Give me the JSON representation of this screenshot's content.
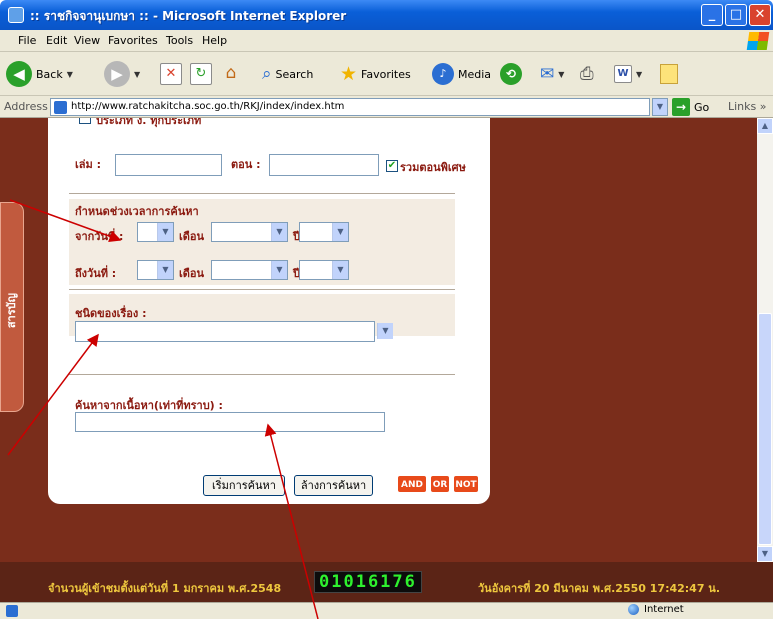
{
  "window": {
    "title": ":: ราชกิจจานุเบกษา :: - Microsoft Internet Explorer"
  },
  "menu": [
    "File",
    "Edit",
    "View",
    "Favorites",
    "Tools",
    "Help"
  ],
  "toolbar": {
    "back": "Back",
    "search": "Search",
    "favorites": "Favorites",
    "media": "Media"
  },
  "address": {
    "label": "Address",
    "url": "http://www.ratchakitcha.soc.go.th/RKJ/index/index.htm",
    "go": "Go",
    "links": "Links"
  },
  "side_tab": "สารบัญ",
  "form": {
    "top_cut_text": "ประเภท ง.  ทุกประเภท",
    "book_label": "เล่ม :",
    "section_label": "ตอน :",
    "special_section_label": "รวมตอนพิเศษ",
    "period_heading": "กำหนดช่วงเวลาการค้นหา",
    "from_date_label": "จากวันที่ :",
    "to_date_label": "ถึงวันที่  :",
    "month_label": "เดือน",
    "year_label": "ปี",
    "category_label": "ชนิดของเรื่อง :",
    "content_search_label": "ค้นหาจากเนื้อหา(เท่าที่ทราบ) :",
    "start_search": "เริ่มการค้นหา",
    "clear_search": "ล้างการค้นหา",
    "and": "AND",
    "or": "OR",
    "not": "NOT"
  },
  "counter": {
    "label": "จำนวนผู้เข้าชมตั้งแต่วันที่ 1 มกราคม พ.ศ.2548",
    "digits": "01016176",
    "date": "วันอังคารที่ 20 มีนาคม พ.ศ.2550 17:42:47 น."
  },
  "status": {
    "zone": "Internet"
  },
  "colors": {
    "page_bg": "#7a2d1b",
    "label_red": "#8b1a10",
    "counter_green": "#2ef12e",
    "annotation_red": "#cc0000"
  }
}
